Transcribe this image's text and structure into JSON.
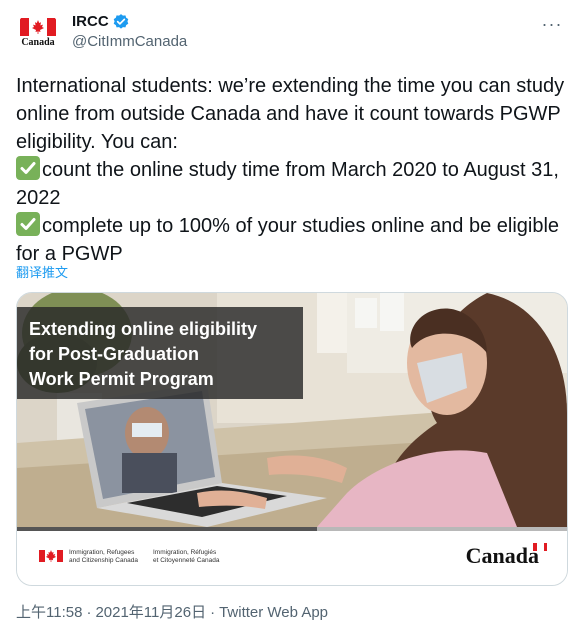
{
  "author": {
    "display_name": "IRCC",
    "handle": "@CitImmCanada",
    "avatar_wordmark": "Canada",
    "verified": true
  },
  "tweet": {
    "line1": "International students: we’re extending the time you can study online from outside Canada and have it count towards PGWP eligibility. You can:",
    "bullet1": "count the online study time from March 2020 to August 31, 2022",
    "bullet2": "complete up to 100% of your studies online and be eligible for a PGWP",
    "bullet_icon": "check-mark-emoji"
  },
  "translate_label": "翻译推文",
  "media": {
    "banner_line1": "Extending online eligibility",
    "banner_line2": "for Post-Graduation",
    "banner_line3": "Work Permit Program",
    "gov_en_line1": "Immigration, Refugees",
    "gov_en_line2": "and Citizenship Canada",
    "gov_fr_line1": "Immigration, Réfugiés",
    "gov_fr_line2": "et Citoyenneté Canada",
    "wordmark": "Canada"
  },
  "meta": {
    "time": "上午11:58",
    "date": "2021年11月26日",
    "source": "Twitter Web App"
  },
  "colors": {
    "link": "#1d9bf0",
    "verified": "#1d9bf0",
    "canada_red": "#e11b22",
    "muted": "#536471"
  }
}
